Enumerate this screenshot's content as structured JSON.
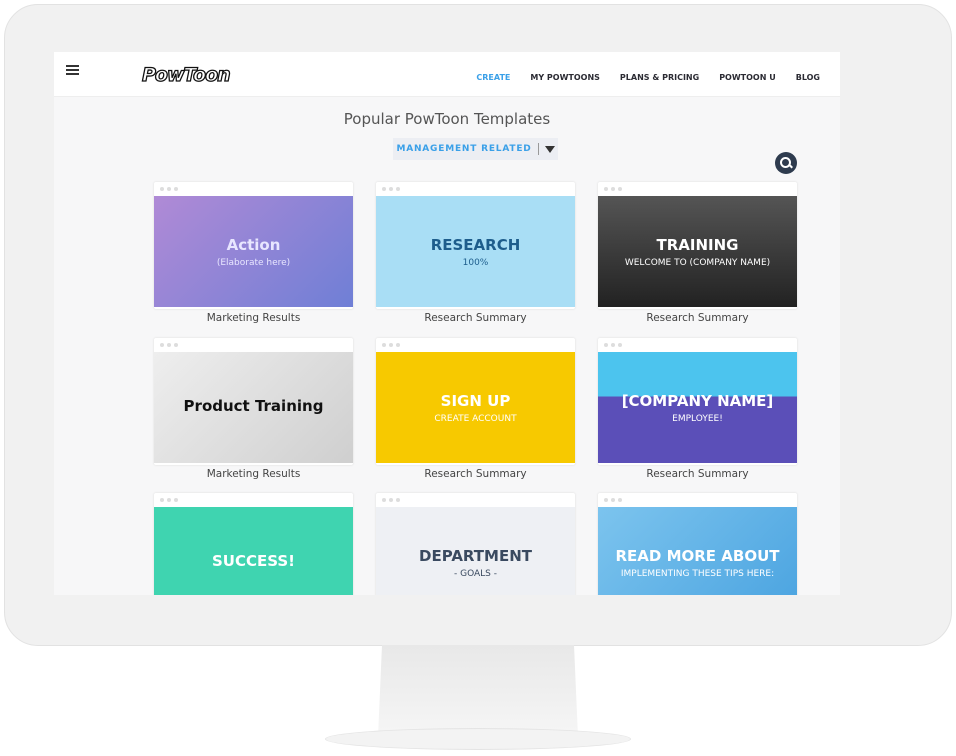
{
  "nav": {
    "logo": "PowToon",
    "links": [
      {
        "label": "CREATE",
        "active": true
      },
      {
        "label": "MY POWTOONS"
      },
      {
        "label": "PLANS & PRICING"
      },
      {
        "label": "POWTOON U"
      },
      {
        "label": "BLOG"
      }
    ]
  },
  "page_title": "Popular PowToon Templates",
  "filter": {
    "selected": "MANAGEMENT RELATED"
  },
  "templates": [
    {
      "label": "Marketing Results",
      "thumb_text": "Action",
      "thumb_sub": "(Elaborate here)",
      "bg": "linear-gradient(135deg,#b08ad6,#6f7fd6)",
      "color": "#e8e6ff"
    },
    {
      "label": "Research Summary",
      "thumb_text": "RESEARCH",
      "thumb_sub": "100%",
      "bg": "#a9def5",
      "color": "#1d5d8c"
    },
    {
      "label": "Research Summary",
      "thumb_text": "TRAINING",
      "thumb_sub": "WELCOME TO (COMPANY NAME)",
      "bg": "linear-gradient(#555,#222)",
      "color": "#fff"
    },
    {
      "label": "Marketing Results",
      "thumb_text": "Product Training",
      "thumb_sub": "",
      "bg": "linear-gradient(135deg,#eee,#cfcfcf)",
      "color": "#111"
    },
    {
      "label": "Research Summary",
      "thumb_text": "SIGN UP",
      "thumb_sub": "CREATE ACCOUNT",
      "bg": "#f7c900",
      "color": "#fff"
    },
    {
      "label": "Research Summary",
      "thumb_text": "[COMPANY NAME]",
      "thumb_sub": "EMPLOYEE!",
      "bg": "linear-gradient(#4cc4ee 40%,#5b4fb8 40%)",
      "color": "#fff"
    },
    {
      "label": "",
      "thumb_text": "SUCCESS!",
      "thumb_sub": "",
      "bg": "#3fd4b0",
      "color": "#fff"
    },
    {
      "label": "",
      "thumb_text": "DEPARTMENT",
      "thumb_sub": "- GOALS -",
      "bg": "#eef0f4",
      "color": "#3a4a60"
    },
    {
      "label": "",
      "thumb_text": "READ MORE ABOUT",
      "thumb_sub": "IMPLEMENTING THESE TIPS HERE:",
      "bg": "linear-gradient(135deg,#7cc4ee,#4aa3e0)",
      "color": "#fff"
    }
  ]
}
